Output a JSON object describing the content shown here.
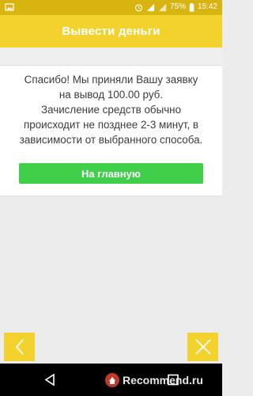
{
  "status_bar": {
    "battery_text": "75%",
    "time": "15:42"
  },
  "app_bar": {
    "title": "Вывести деньги"
  },
  "message": {
    "lines": [
      "Спасибо! Мы приняли Вашу заявку",
      "на вывод 100.00 руб.",
      "Зачисление средств обычно",
      "происходит не позднее 2-3 минут, в",
      "зависимости от выбранного способа."
    ]
  },
  "home_button": {
    "label": "На главную"
  },
  "bottom_actions": {
    "back_icon": "chevron-left-icon",
    "close_icon": "close-icon"
  },
  "nav_bar": {
    "back_icon": "nav-back-icon",
    "home_icon": "nav-home-icon",
    "recents_icon": "nav-recents-icon"
  },
  "watermark": {
    "text": "Recommend.ru"
  },
  "colors": {
    "accent_yellow": "#f4d22e",
    "status_yellow": "#d8b410",
    "button_green": "#3fcf4a"
  }
}
